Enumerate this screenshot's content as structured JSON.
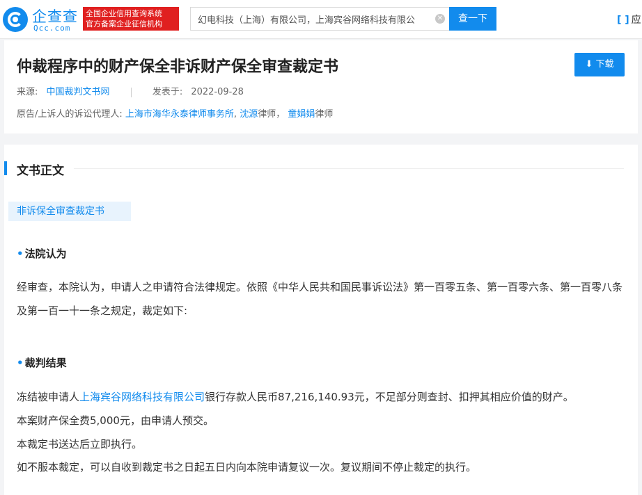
{
  "header": {
    "logo_text": "企查查",
    "logo_sub": "Qcc.com",
    "badge_line1": "全国企业信用查询系统",
    "badge_line2": "官方备案企业征信机构",
    "search_value": "幻电科技（上海）有限公司，上海宾谷网络科技有限公",
    "search_button": "查一下",
    "app_link": "应"
  },
  "document": {
    "title": "仲裁程序中的财产保全非诉财产保全审查裁定书",
    "download_label": "下载",
    "source_label": "来源:",
    "source_value": "中国裁判文书网",
    "published_label": "发表于:",
    "published_date": "2022-09-28",
    "agent_label": "原告/上诉人的诉讼代理人:",
    "agent_firm": "上海市海华永泰律师事务所",
    "agent_sep1": ",",
    "agent_name1": "沈源",
    "agent_role1": "律师，",
    "agent_name2": "童娟娟",
    "agent_role2": "律师"
  },
  "body": {
    "section_title": "文书正文",
    "doc_type_tag": "非诉保全审查裁定书",
    "court_opinion_head": "法院认为",
    "court_opinion_text": "经审查，本院认为，申请人之申请符合法律规定。依照《中华人民共和国民事诉讼法》第一百零五条、第一百零六条、第一百零八条及第一百一十一条之规定，裁定如下:",
    "judgment_head": "裁判结果",
    "judgment_line1_pre": "冻结被申请人",
    "judgment_line1_company": "上海宾谷网络科技有限公司",
    "judgment_line1_post": "银行存款人民币87,216,140.93元，不足部分则查封、扣押其相应价值的财产。",
    "judgment_line2": "本案财产保全费5,000元，由申请人预交。",
    "judgment_line3": "本裁定书送达后立即执行。",
    "judgment_line4": "如不服本裁定，可以自收到裁定书之日起五日内向本院申请复议一次。复议期间不停止裁定的执行。"
  },
  "colors": {
    "accent": "#128bed",
    "badge_red": "#e02020"
  }
}
